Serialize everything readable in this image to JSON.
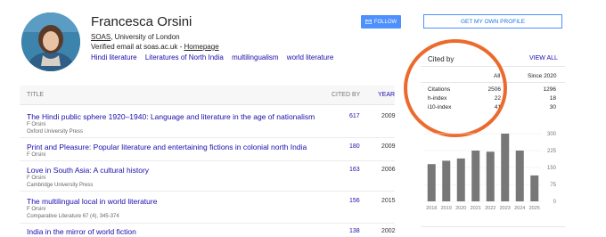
{
  "profile": {
    "name": "Francesca Orsini",
    "affiliation_link": "SOAS",
    "affiliation_rest": ", University of London",
    "verified_text": "Verified email at soas.ac.uk - ",
    "homepage_label": "Homepage",
    "topics": [
      "Hindi literature",
      "Literatures of North India",
      "multilingualism",
      "world literature"
    ]
  },
  "buttons": {
    "follow": "FOLLOW",
    "own_profile": "GET MY OWN PROFILE"
  },
  "table": {
    "headers": {
      "title": "TITLE",
      "cited_by": "CITED BY",
      "year": "YEAR"
    },
    "rows": [
      {
        "title": "The Hindi public sphere 1920–1940: Language and literature in the age of nationalism",
        "authors": "F Orsini",
        "venue": "Oxford University Press",
        "cited": "617",
        "year": "2009"
      },
      {
        "title": "Print and Pleasure: Popular literature and entertaining fictions in colonial north India",
        "authors": "F Orsini",
        "venue": "",
        "cited": "180",
        "year": "2009"
      },
      {
        "title": "Love in South Asia: A cultural history",
        "authors": "F Orsini",
        "venue": "Cambridge University Press",
        "cited": "163",
        "year": "2006"
      },
      {
        "title": "The multilingual local in world literature",
        "authors": "F Orsini",
        "venue": "Comparative Literature 67 (4), 345-374",
        "cited": "156",
        "year": "2015"
      },
      {
        "title": "India in the mirror of world fiction",
        "authors": "",
        "venue": "",
        "cited": "138",
        "year": "2002"
      }
    ]
  },
  "cited_by": {
    "title": "Cited by",
    "view_all": "VIEW ALL",
    "col_all": "All",
    "col_since": "Since 2020",
    "rows": [
      {
        "label": "Citations",
        "all": "2506",
        "since": "1296"
      },
      {
        "label": "h-index",
        "all": "22",
        "since": "18"
      },
      {
        "label": "i10-index",
        "all": "41",
        "since": "30"
      }
    ]
  },
  "chart_data": {
    "type": "bar",
    "categories": [
      "2018",
      "2019",
      "2020",
      "2021",
      "2022",
      "2023",
      "2024",
      "2025"
    ],
    "values": [
      165,
      180,
      190,
      225,
      220,
      300,
      225,
      115
    ],
    "ylim": [
      0,
      300
    ],
    "yticks": [
      "300",
      "225",
      "150",
      "75",
      "0"
    ],
    "bar_color": "#777777"
  },
  "colors": {
    "link": "#1a0dab",
    "accent_button": "#4d90fe",
    "annotation_ring": "#ec6a2d"
  }
}
